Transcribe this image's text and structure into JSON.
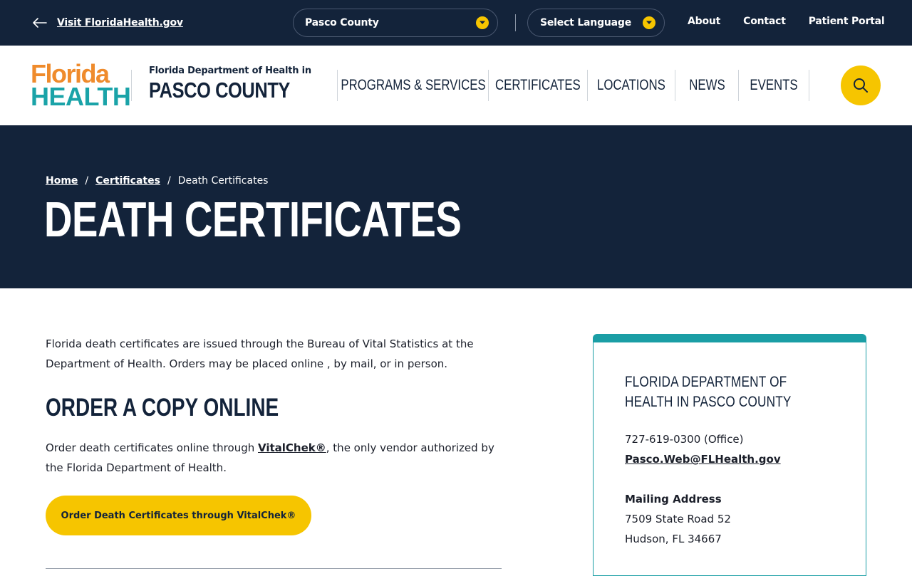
{
  "topbar": {
    "back_link": "Visit FloridaHealth.gov",
    "county_select": "Pasco County",
    "language_select": "Select Language",
    "links": [
      "About",
      "Contact",
      "Patient Portal"
    ]
  },
  "header": {
    "logo_line1": "Florida",
    "logo_line2": "HEALTH",
    "dept_small": "Florida Department of Health in",
    "dept_big": "PASCO COUNTY",
    "nav": [
      "PROGRAMS & SERVICES",
      "CERTIFICATES",
      "LOCATIONS",
      "NEWS",
      "EVENTS"
    ]
  },
  "hero": {
    "breadcrumb": {
      "home": "Home",
      "sep": "/",
      "certificates": "Certificates",
      "current": "Death Certificates"
    },
    "title": "DEATH CERTIFICATES"
  },
  "main": {
    "intro": "Florida death certificates are issued through the Bureau of Vital Statistics at the Department of Health. Orders may be placed online , by mail, or in person.",
    "section_heading": "ORDER A COPY ONLINE",
    "order_text_before": "Order death certificates online through ",
    "order_link": "VitalChek®",
    "order_text_after": ", the only vendor authorized by the Florida Department of Health.",
    "cta_label": "Order Death Certificates through VitalChek®"
  },
  "sidebar": {
    "title": "FLORIDA DEPARTMENT OF HEALTH IN PASCO COUNTY",
    "phone": "727-619-0300 (Office)",
    "email": "Pasco.Web@FLHealth.gov",
    "mailing_heading": "Mailing Address",
    "address_line1": "7509 State Road 52",
    "address_line2": "Hudson, FL 34667"
  },
  "colors": {
    "navy": "#13233a",
    "yellow": "#f6c500",
    "teal": "#1a9ea5",
    "orange": "#ef8b2c"
  },
  "icons": {
    "back": "arrow-left-icon",
    "dropdown": "chevron-down-icon",
    "search": "search-icon"
  }
}
